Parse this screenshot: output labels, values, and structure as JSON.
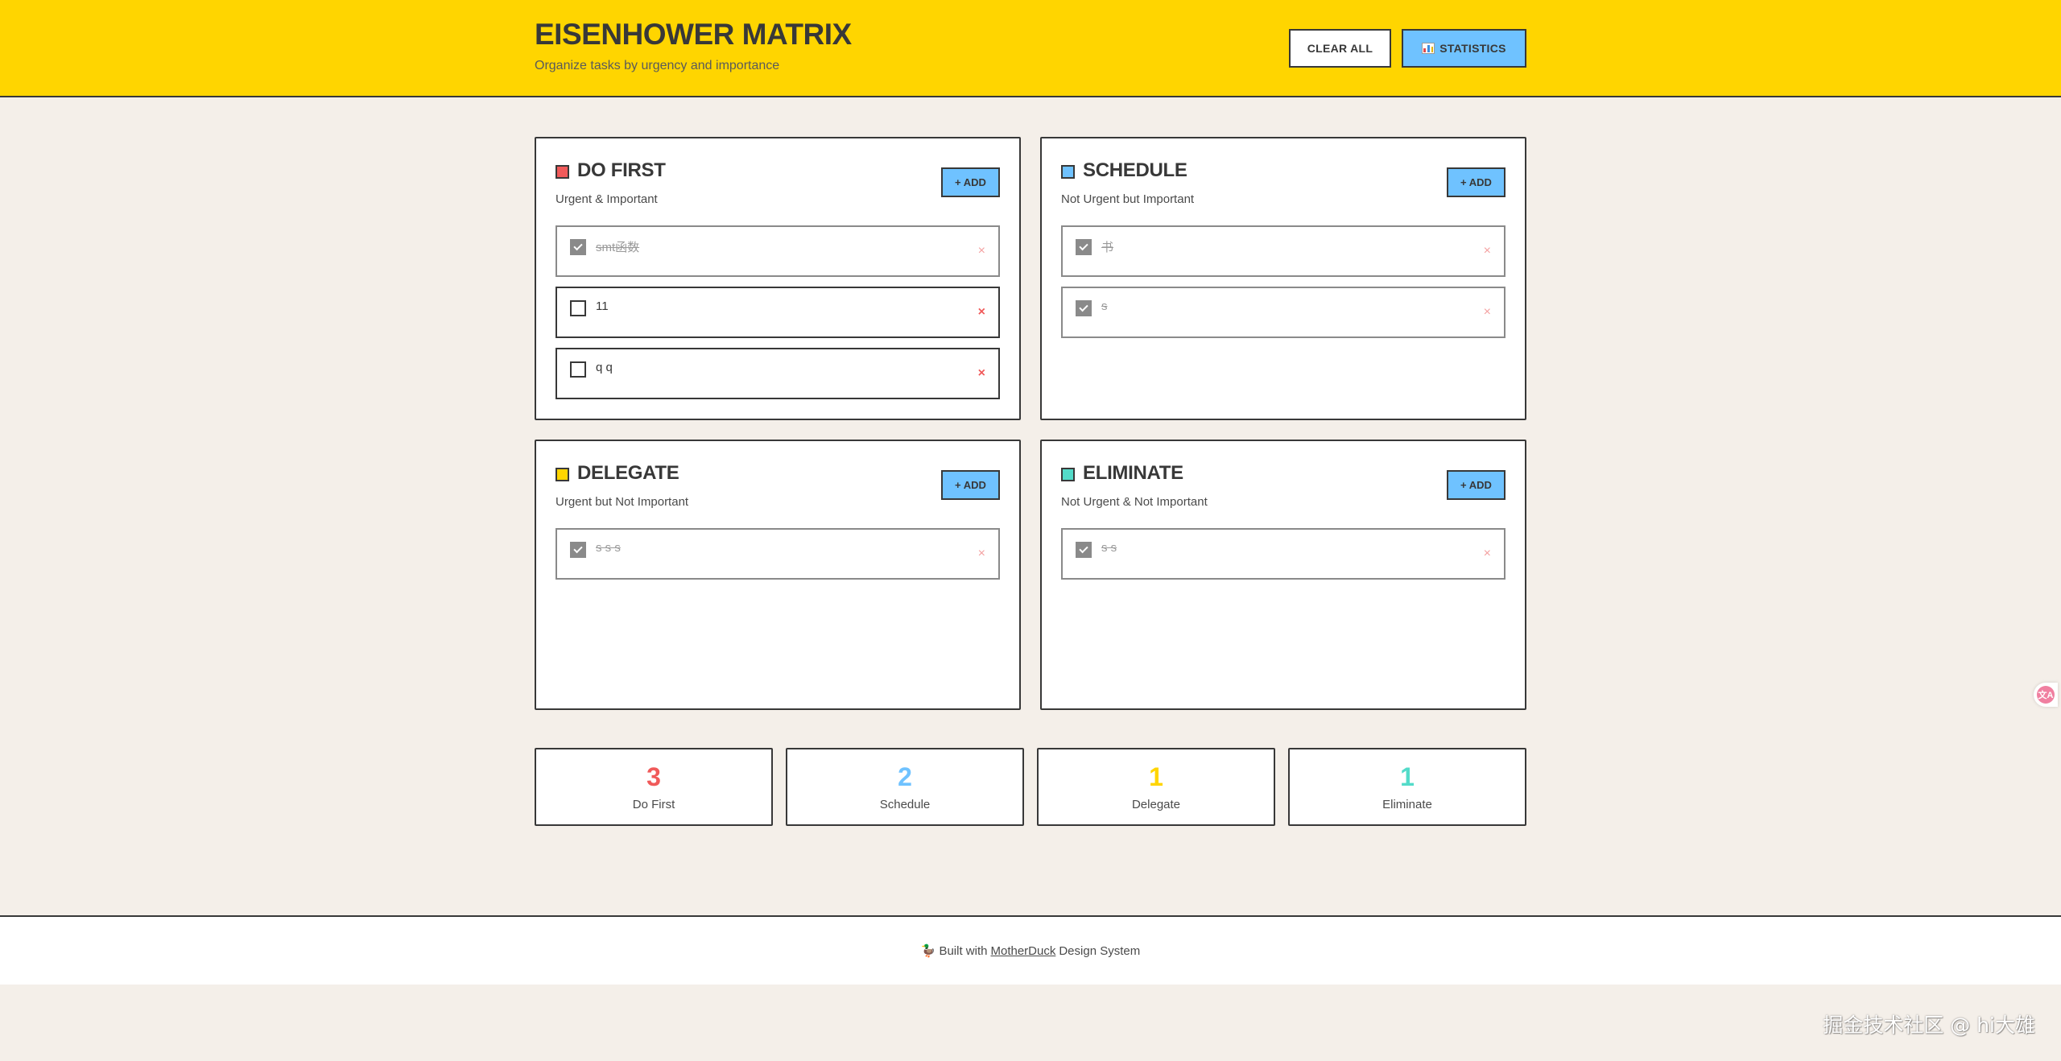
{
  "header": {
    "title": "EISENHOWER MATRIX",
    "subtitle": "Organize tasks by urgency and importance",
    "clear_label": "CLEAR ALL",
    "stats_label": "STATISTICS"
  },
  "colors": {
    "header_bg": "#ffd500",
    "page_bg": "#f4efe9",
    "accent_blue": "#6fc2ff",
    "do_first": "#f05a5a",
    "schedule": "#6fc2ff",
    "delegate": "#ffd500",
    "eliminate": "#53dbc9"
  },
  "add_label": "+ ADD",
  "quadrants": [
    {
      "key": "do_first",
      "title": "DO FIRST",
      "subtitle": "Urgent & Important",
      "tasks": [
        {
          "text": "smt函数",
          "done": true
        },
        {
          "text": "11",
          "done": false
        },
        {
          "text": "q q",
          "done": false
        }
      ]
    },
    {
      "key": "schedule",
      "title": "SCHEDULE",
      "subtitle": "Not Urgent but Important",
      "tasks": [
        {
          "text": "书",
          "done": true
        },
        {
          "text": "s",
          "done": true
        }
      ]
    },
    {
      "key": "delegate",
      "title": "DELEGATE",
      "subtitle": "Urgent but Not Important",
      "tasks": [
        {
          "text": "s s s",
          "done": true
        }
      ]
    },
    {
      "key": "eliminate",
      "title": "ELIMINATE",
      "subtitle": "Not Urgent & Not Important",
      "tasks": [
        {
          "text": "s s",
          "done": true
        }
      ]
    }
  ],
  "delete_glyph": "×",
  "stats": [
    {
      "count": "3",
      "label": "Do First",
      "color": "#f05a5a"
    },
    {
      "count": "2",
      "label": "Schedule",
      "color": "#6fc2ff"
    },
    {
      "count": "1",
      "label": "Delegate",
      "color": "#ffd500"
    },
    {
      "count": "1",
      "label": "Eliminate",
      "color": "#53dbc9"
    }
  ],
  "footer": {
    "duck": "🦆",
    "prefix": "Built with",
    "link": "MotherDuck",
    "suffix": "Design System"
  },
  "translate_glyph": "文A",
  "watermark": "掘金技术社区 @ hi大雄"
}
